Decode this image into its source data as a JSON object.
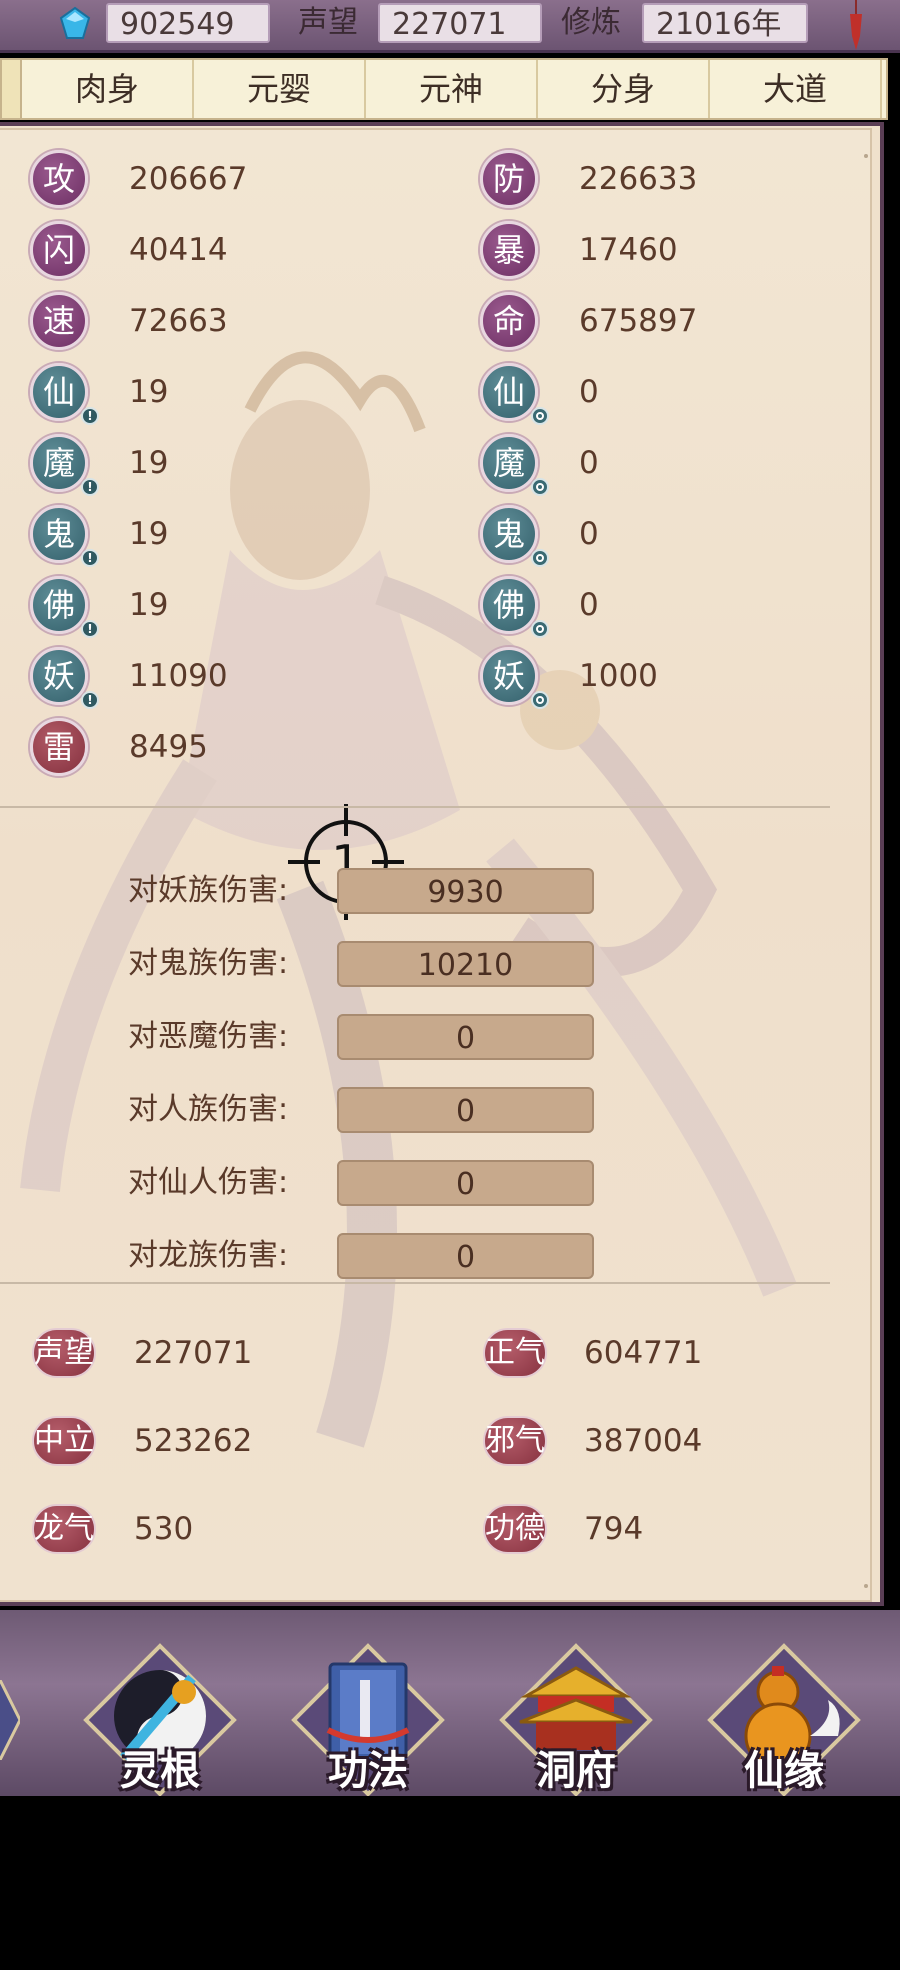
{
  "topbar": {
    "currency_value": "902549",
    "reputation_label": "声望",
    "reputation_value": "227071",
    "cultivation_label": "修炼",
    "cultivation_value": "21016年"
  },
  "tabs": [
    "肉身",
    "元婴",
    "元神",
    "分身",
    "大道"
  ],
  "stats_left": [
    {
      "icon": "攻",
      "value": "206667"
    },
    {
      "icon": "闪",
      "value": "40414"
    },
    {
      "icon": "速",
      "value": "72663"
    },
    {
      "icon": "仙",
      "value": "19"
    },
    {
      "icon": "魔",
      "value": "19"
    },
    {
      "icon": "鬼",
      "value": "19"
    },
    {
      "icon": "佛",
      "value": "19"
    },
    {
      "icon": "妖",
      "value": "11090"
    },
    {
      "icon": "雷",
      "value": "8495"
    }
  ],
  "stats_right": [
    {
      "icon": "防",
      "value": "226633"
    },
    {
      "icon": "暴",
      "value": "17460"
    },
    {
      "icon": "命",
      "value": "675897"
    },
    {
      "icon": "仙",
      "value": "0"
    },
    {
      "icon": "魔",
      "value": "0"
    },
    {
      "icon": "鬼",
      "value": "0"
    },
    {
      "icon": "佛",
      "value": "0"
    },
    {
      "icon": "妖",
      "value": "1000"
    }
  ],
  "crosshair_number": "1",
  "damage": [
    {
      "label": "对妖族伤害:",
      "value": "9930"
    },
    {
      "label": "对鬼族伤害:",
      "value": "10210"
    },
    {
      "label": "对恶魔伤害:",
      "value": "0"
    },
    {
      "label": "对人族伤害:",
      "value": "0"
    },
    {
      "label": "对仙人伤害:",
      "value": "0"
    },
    {
      "label": "对龙族伤害:",
      "value": "0"
    }
  ],
  "reputation": [
    {
      "icon": "声望",
      "value": "227071"
    },
    {
      "icon": "正气",
      "value": "604771"
    },
    {
      "icon": "中立",
      "value": "523262"
    },
    {
      "icon": "邪气",
      "value": "387004"
    },
    {
      "icon": "龙气",
      "value": "530"
    },
    {
      "icon": "功德",
      "value": "794"
    }
  ],
  "bottom_menu": [
    "灵根",
    "功法",
    "洞府",
    "仙缘"
  ],
  "colors": {
    "frame": "#5a3e55",
    "panel": "#efe1cc",
    "stat_purple": "#7a3a70",
    "stat_teal": "#3e6d77",
    "stat_red": "#943845"
  }
}
